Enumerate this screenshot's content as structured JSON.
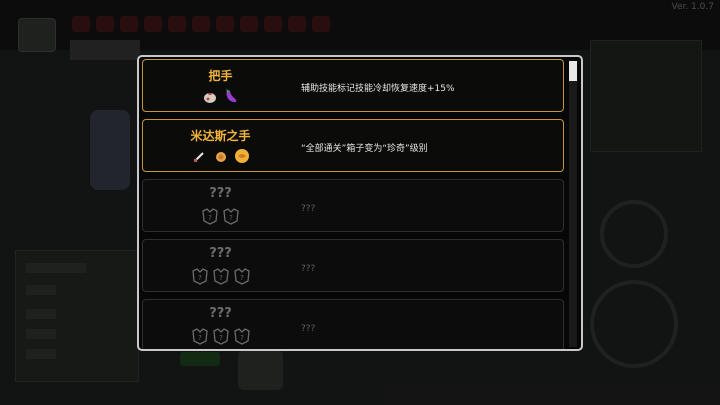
{
  "version": "Ver. 1.0.7",
  "dialog": {
    "entries": [
      {
        "state": "unlocked",
        "name": "把手",
        "description": "辅助技能标记技能冷却恢复速度+15%",
        "items": [
          "sack-icon",
          "eggplant-icon"
        ]
      },
      {
        "state": "unlocked",
        "name": "米达斯之手",
        "description": "“全部通关”箱子变为“珍奇”级别",
        "items": [
          "sword-icon",
          "coin-icon",
          "gold-orb-icon"
        ]
      },
      {
        "state": "locked",
        "name": "???",
        "description": "???",
        "items": [
          "locked-item-icon",
          "locked-item-icon"
        ]
      },
      {
        "state": "locked",
        "name": "???",
        "description": "???",
        "items": [
          "locked-item-icon",
          "locked-item-icon",
          "locked-item-icon"
        ]
      },
      {
        "state": "locked",
        "name": "???",
        "description": "???",
        "items": [
          "locked-item-icon",
          "locked-item-icon",
          "locked-item-icon"
        ]
      }
    ]
  },
  "colors": {
    "unlocked_name": "#f2b43c",
    "unlocked_border": "#c4953f",
    "locked_text": "#6b6b6b"
  }
}
